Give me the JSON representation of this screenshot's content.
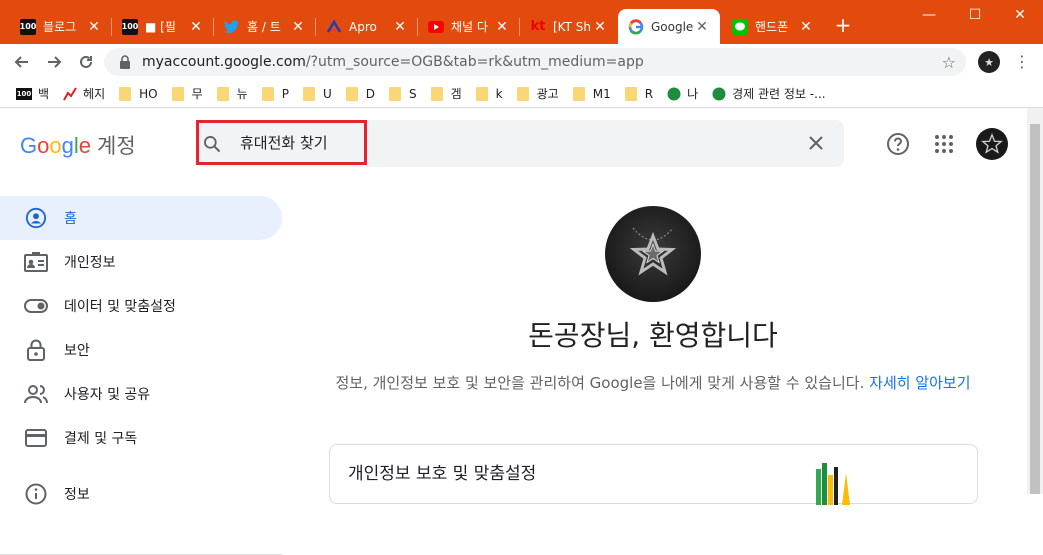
{
  "tabs": [
    {
      "title": "블로그",
      "favicon": "100-icon"
    },
    {
      "title": "■ [필",
      "favicon": "100-icon"
    },
    {
      "title": "홈 / 트",
      "favicon": "twitter-icon"
    },
    {
      "title": "Apro",
      "favicon": "apro-icon"
    },
    {
      "title": "채널 다",
      "favicon": "youtube-icon"
    },
    {
      "title": "[KT Sh",
      "favicon": "kt-icon"
    },
    {
      "title": "Google",
      "favicon": "google-icon"
    },
    {
      "title": "핸드폰",
      "favicon": "line-icon"
    }
  ],
  "window": {
    "minimize": "—",
    "maximize": "☐",
    "close": "✕",
    "new_tab": "+"
  },
  "address": {
    "domain": "myaccount.google.com",
    "path": "/?utm_source=OGB&tab=rk&utm_medium=app"
  },
  "bookmarks": [
    {
      "label": "백",
      "icon": "100-icon"
    },
    {
      "label": "헤지",
      "icon": "chart-icon"
    },
    {
      "label": "HO",
      "icon": "folder-icon"
    },
    {
      "label": "무",
      "icon": "folder-icon"
    },
    {
      "label": "뉴",
      "icon": "folder-icon"
    },
    {
      "label": "P",
      "icon": "folder-icon"
    },
    {
      "label": "U",
      "icon": "folder-icon"
    },
    {
      "label": "D",
      "icon": "folder-icon"
    },
    {
      "label": "S",
      "icon": "folder-icon"
    },
    {
      "label": "겜",
      "icon": "folder-icon"
    },
    {
      "label": "k",
      "icon": "folder-icon"
    },
    {
      "label": "광고",
      "icon": "folder-icon"
    },
    {
      "label": "M1",
      "icon": "folder-icon"
    },
    {
      "label": "R",
      "icon": "folder-icon"
    },
    {
      "label": "나",
      "icon": "green-circle-icon"
    },
    {
      "label": "경제 관련 정보 -...",
      "icon": "green-circle-icon"
    }
  ],
  "header": {
    "logo_google": [
      "G",
      "o",
      "o",
      "g",
      "l",
      "e"
    ],
    "logo_account": "계정",
    "search_value": "휴대전화 찾기"
  },
  "sidenav": [
    {
      "label": "홈",
      "icon": "home-person-icon",
      "active": true
    },
    {
      "label": "개인정보",
      "icon": "id-card-icon",
      "active": false
    },
    {
      "label": "데이터 및 맞춤설정",
      "icon": "toggle-icon",
      "active": false
    },
    {
      "label": "보안",
      "icon": "lock-icon",
      "active": false
    },
    {
      "label": "사용자 및 공유",
      "icon": "people-icon",
      "active": false
    },
    {
      "label": "결제 및 구독",
      "icon": "credit-card-icon",
      "active": false
    },
    {
      "label": "정보",
      "icon": "info-icon",
      "active": false
    }
  ],
  "main": {
    "welcome": "돈공장님, 환영합니다",
    "description": "정보, 개인정보 보호 및 보안을 관리하여 Google을 나에게 맞게 사용할 수 있습니다.",
    "link": "자세히 알아보기",
    "card_title": "개인정보 보호 및 맞춤설정"
  },
  "colors": {
    "tabbar": "#e24a0e",
    "active_nav": "#e8f0fe",
    "link": "#1a73e8",
    "highlight_box": "#e4262b"
  }
}
